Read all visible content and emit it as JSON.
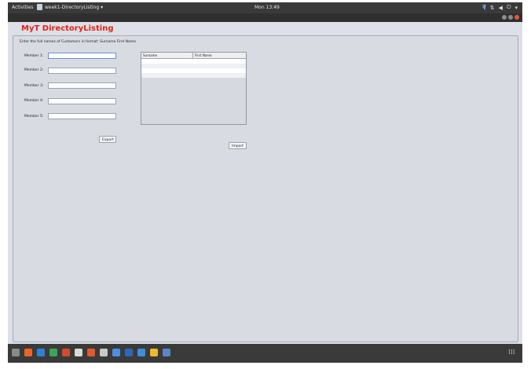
{
  "topbar": {
    "activities": "Activities",
    "app_name": "week1-DirectoryListing ▾",
    "clock": "Mon 13:49"
  },
  "app": {
    "title": "MyT DirectoryListing",
    "instructions": "Enter the full names of Customers in format: Surname First Name",
    "members": [
      {
        "label": "Member 1:",
        "value": ""
      },
      {
        "label": "Member 2:",
        "value": ""
      },
      {
        "label": "Member 3:",
        "value": ""
      },
      {
        "label": "Member 4:",
        "value": ""
      },
      {
        "label": "Member 5:",
        "value": ""
      }
    ],
    "table": {
      "columns": [
        "Surname",
        "First Name"
      ],
      "rows": []
    },
    "buttons": {
      "export": "Export",
      "import": "Import"
    }
  },
  "dock": {
    "apps": [
      {
        "icon": "files-icon",
        "color": "#8a8a8a"
      },
      {
        "icon": "firefox-icon",
        "color": "#e8662a"
      },
      {
        "icon": "document-icon",
        "color": "#2f7fd6"
      },
      {
        "icon": "spreadsheet-icon",
        "color": "#3aa757"
      },
      {
        "icon": "presentation-icon",
        "color": "#d24a2f"
      },
      {
        "icon": "editor-icon",
        "color": "#d9d9d9"
      },
      {
        "icon": "software-icon",
        "color": "#e05a2b"
      },
      {
        "icon": "settings-icon",
        "color": "#c9c9c9"
      },
      {
        "icon": "chrome-icon",
        "color": "#4a90e2"
      },
      {
        "icon": "terminal-icon",
        "color": "#2f67b8"
      },
      {
        "icon": "vscode-icon",
        "color": "#3c8fd8"
      },
      {
        "icon": "lightning-icon",
        "color": "#f2b829"
      },
      {
        "icon": "java-icon",
        "color": "#5b86c7"
      }
    ]
  }
}
